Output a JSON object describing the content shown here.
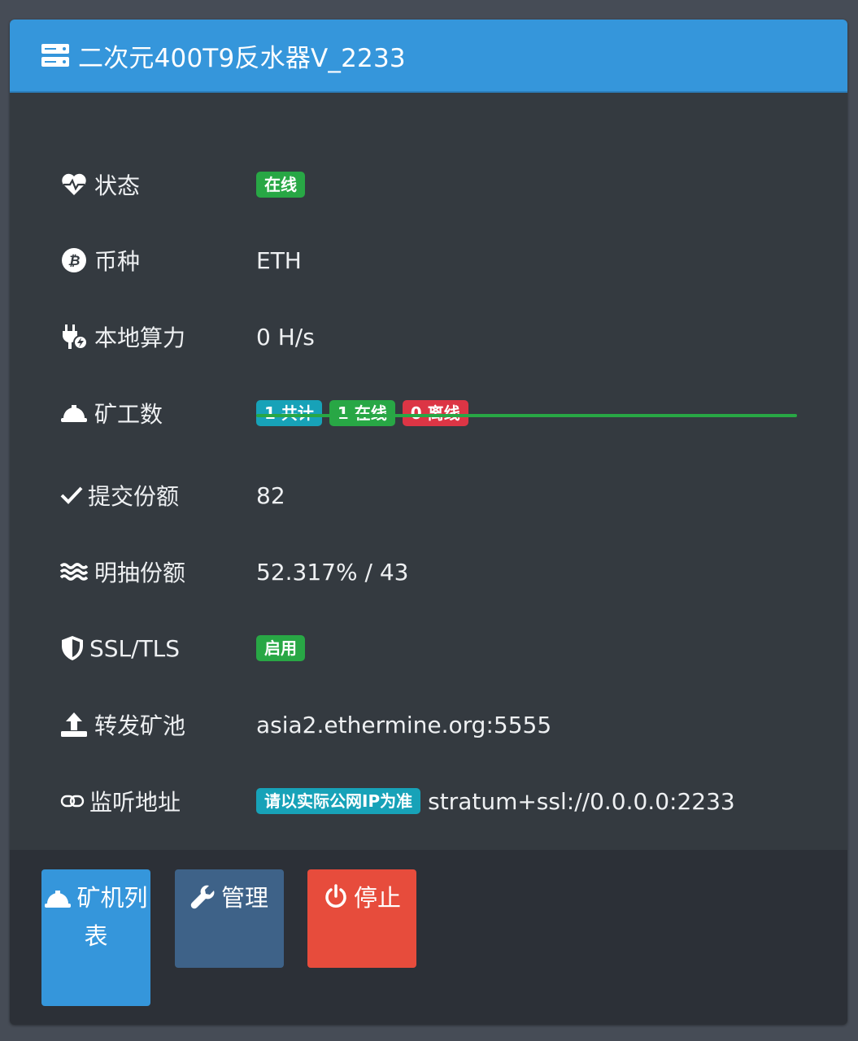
{
  "header": {
    "title": "二次元400T9反水器V_2233",
    "icon": "server-icon"
  },
  "rows": {
    "status": {
      "label": "状态",
      "icon": "heartbeat-icon",
      "badge": "在线"
    },
    "coin": {
      "label": "币种",
      "icon": "bitcoin-icon",
      "value": "ETH"
    },
    "hashrate": {
      "label": "本地算力",
      "icon": "plug-icon",
      "value": "0 H/s"
    },
    "miners": {
      "label": "矿工数",
      "icon": "hard-hat-icon",
      "total": "1 共计",
      "online": "1 在线",
      "offline": "0 离线",
      "online_fraction": 1.0
    },
    "shares": {
      "label": "提交份额",
      "icon": "check-icon",
      "value": "82"
    },
    "fee": {
      "label": "明抽份额",
      "icon": "water-icon",
      "value": "52.317% / 43"
    },
    "ssl": {
      "label": "SSL/TLS",
      "icon": "shield-icon",
      "badge": "启用"
    },
    "pool": {
      "label": "转发矿池",
      "icon": "upload-icon",
      "value": "asia2.ethermine.org:5555"
    },
    "listen": {
      "label": "监听地址",
      "icon": "link-icon",
      "badge": "请以实际公网IP为准",
      "value": "stratum+ssl://0.0.0.0:2233"
    }
  },
  "buttons": {
    "miner_list": "矿机列表",
    "manage": "管理",
    "stop": "停止"
  },
  "colors": {
    "header": "#3596db",
    "card": "#343a40",
    "footer": "#2c3037",
    "green": "#28a745",
    "cyan": "#17a2b8",
    "red": "#dc3545",
    "manage_btn": "#3e6288",
    "stop_btn": "#e74c3c"
  }
}
